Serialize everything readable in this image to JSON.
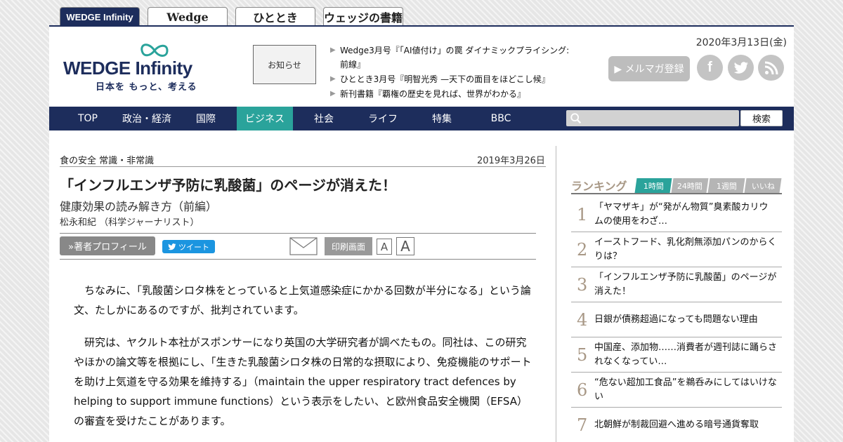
{
  "site_tabs": [
    {
      "label": "WEDGE Infinity"
    },
    {
      "label": "Wedge"
    },
    {
      "label": "ひととき"
    },
    {
      "label": "ウェッジの書籍"
    }
  ],
  "header": {
    "logo_text": "WEDGE Infinity",
    "logo_subtitle": "日本を もっと、考える",
    "notice_label": "お知らせ",
    "news": [
      "Wedge3月号『「AI値付け」の罠 ダイナミックプライシング: 前線』",
      "ひととき3月号『明智光秀 —天下の面目をほどこし候』",
      "新刊書籍『覇権の歴史を見れば、世界がわかる』"
    ],
    "date": "2020年3月13日(金)",
    "mail_magazine": "▶ メルマガ登録"
  },
  "nav": {
    "items": [
      "TOP",
      "政治・経済",
      "国際",
      "ビジネス",
      "社会",
      "ライフ",
      "特集",
      "BBC"
    ],
    "active": "ビジネス",
    "search_button": "検索"
  },
  "article": {
    "category": "食の安全 常識・非常識",
    "date": "2019年3月26日",
    "title": "「インフルエンザ予防に乳酸菌」のページが消えた！",
    "subtitle": "健康効果の読み解き方（前編）",
    "author": "松永和紀 （科学ジャーナリスト）",
    "profile_button": "»著者プロフィール",
    "tweet_button": "ツイート",
    "print_button": "印刷画面",
    "font_small": "A",
    "font_large": "A",
    "paragraphs": [
      "ちなみに、「乳酸菌シロタ株をとっていると上気道感染症にかかる回数が半分になる」という論文、たしかにあるのですが、批判されています。",
      "研究は、ヤクルト本社がスポンサーになり英国の大学研究者が調べたもの。同社は、この研究やほかの論文等を根拠にし、「生きた乳酸菌シロタ株の日常的な摂取により、免疫機能のサポートを助け上気道を守る効果を維持する」（maintain the upper respiratory tract defences by helping to support immune functions）という表示をしたい、と欧州食品安全機関（EFSA）の審査を受けたことがあります。"
    ]
  },
  "ranking": {
    "title": "ランキング",
    "tabs": [
      "1時間",
      "24時間",
      "1週間",
      "いいね"
    ],
    "active_tab": "1時間",
    "items": [
      {
        "rank": "1",
        "text": "「ヤマザキ」が“発がん物質”臭素酸カリウムの使用をわざ…"
      },
      {
        "rank": "2",
        "text": "イーストフード、乳化剤無添加パンのからくりは？"
      },
      {
        "rank": "3",
        "text": "「インフルエンザ予防に乳酸菌」のページが消えた！"
      },
      {
        "rank": "4",
        "text": "日銀が債務超過になっても問題ない理由"
      },
      {
        "rank": "5",
        "text": "中国産、添加物……消費者が週刊誌に踊らされなくなってい…"
      },
      {
        "rank": "6",
        "text": "“危ない超加工食品”を鵜呑みにしてはいけない"
      },
      {
        "rank": "7",
        "text": "北朝鮮が制裁回避へ進める暗号通貨奪取"
      }
    ]
  },
  "colors": {
    "navy": "#1d2d5c",
    "accent_teal": "#2aa39b",
    "ranking_gold": "#a89886",
    "tweet_blue": "#1b95e0"
  },
  "icons": {
    "social": [
      "facebook-icon",
      "twitter-icon",
      "rss-icon"
    ],
    "search": "search-icon",
    "mail": "mail-icon"
  }
}
